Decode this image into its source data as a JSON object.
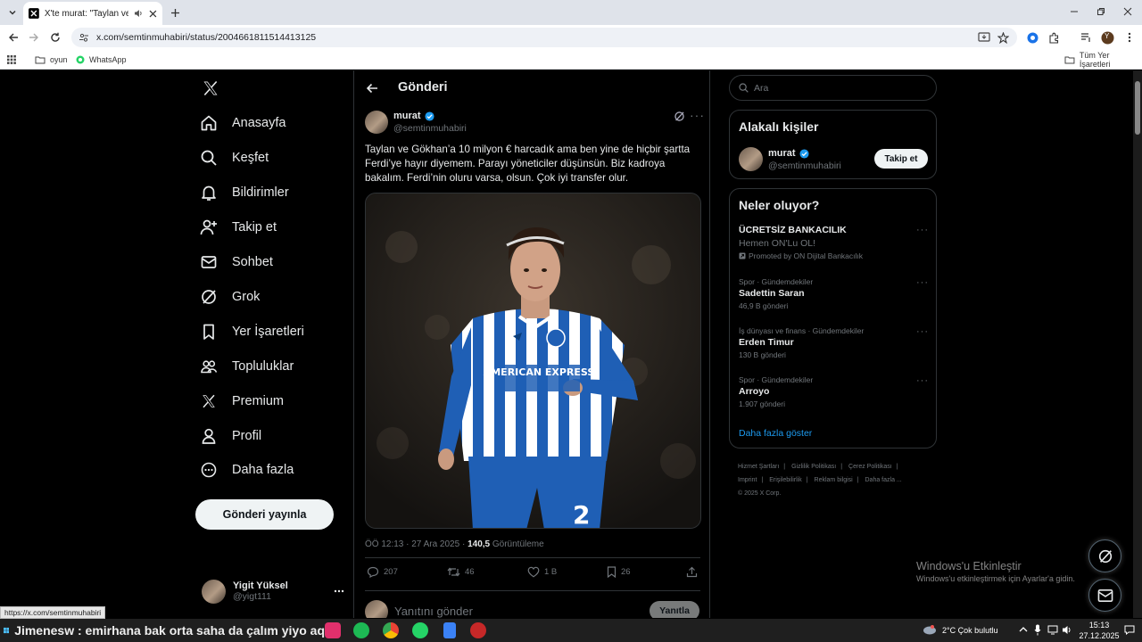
{
  "browser": {
    "tab_title": "X'te murat: \"Taylan ve Gökh",
    "url": "x.com/semtinmuhabiri/status/2004661811514413125",
    "bookmarks": [
      "oyun",
      "WhatsApp"
    ],
    "all_bookmarks": "Tüm Yer İşaretleri",
    "profile_initial": "Y",
    "status_url": "https://x.com/semtinmuhabiri"
  },
  "sidebar": {
    "items": [
      {
        "label": "Anasayfa",
        "icon": "home-icon"
      },
      {
        "label": "Keşfet",
        "icon": "search-icon"
      },
      {
        "label": "Bildirimler",
        "icon": "bell-icon"
      },
      {
        "label": "Takip et",
        "icon": "add-person-icon"
      },
      {
        "label": "Sohbet",
        "icon": "mail-icon"
      },
      {
        "label": "Grok",
        "icon": "grok-icon"
      },
      {
        "label": "Yer İşaretleri",
        "icon": "bookmark-icon"
      },
      {
        "label": "Topluluklar",
        "icon": "communities-icon"
      },
      {
        "label": "Premium",
        "icon": "x-icon"
      },
      {
        "label": "Profil",
        "icon": "person-icon"
      },
      {
        "label": "Daha fazla",
        "icon": "more-circle-icon"
      }
    ],
    "post_button": "Gönderi yayınla",
    "account": {
      "name": "Yigit Yüksel",
      "handle": "@yigt111"
    }
  },
  "main": {
    "title": "Gönderi",
    "post": {
      "author_name": "murat",
      "author_handle": "@semtinmuhabiri",
      "text": "Taylan ve Gökhan’a 10 milyon € harcadık ama ben yine de hiçbir şartta Ferdi’ye hayır diyemem. Parayı yöneticiler düşünsün. Biz kadroya bakalım. Ferdi’nin oluru varsa, olsun. Çok iyi transfer olur.",
      "jersey_text": "AMERICAN EXPRESS",
      "time": "ÖÖ 12:13 · 27 Ara 2025 · ",
      "views_count": "140,5",
      "views_label": " Görüntüleme",
      "replies": "207",
      "reposts": "46",
      "likes": "1 B",
      "bookmarks": "26"
    },
    "reply_placeholder": "Yanıtını gönder",
    "reply_button": "Yanıtla"
  },
  "right": {
    "search_placeholder": "Ara",
    "related_title": "Alakalı kişiler",
    "related_person": {
      "name": "murat",
      "handle": "@semtinmuhabiri",
      "follow": "Takip et"
    },
    "trends_title": "Neler oluyor?",
    "trends": [
      {
        "category": "",
        "title": "ÜCRETSİZ BANKACILIK",
        "subtitle": "Hemen ON'Lu OL!",
        "count": "Promoted by ON Dijital Bankacılık"
      },
      {
        "category": "Spor · Gündemdekiler",
        "title": "Sadettin Saran",
        "subtitle": "",
        "count": "46,9 B gönderi"
      },
      {
        "category": "İş dünyası ve finans · Gündemdekiler",
        "title": "Erden Timur",
        "subtitle": "",
        "count": "130 B gönderi"
      },
      {
        "category": "Spor · Gündemdekiler",
        "title": "Arroyo",
        "subtitle": "",
        "count": "1.907 gönderi"
      }
    ],
    "show_more": "Daha fazla göster",
    "footer": [
      "Hizmet Şartları",
      "|",
      "Gizlilik Politikası",
      "|",
      "Çerez Politikası",
      "|",
      "Imprint",
      "|",
      "Erişilebilirlik",
      "|",
      "Reklam bilgisi",
      "|",
      "Daha fazla ...",
      "© 2025 X Corp."
    ]
  },
  "watermark": {
    "title": "Windows'u Etkinleştir",
    "subtitle": "Windows'u etkinleştirmek için Ayarlar'a gidin."
  },
  "taskbar": {
    "ticker": "Jimenesw : emirhana bak orta saha da çalım yiyo aq",
    "weather": "2°C  Çok bulutlu",
    "time": "15:13",
    "date": "27.12.2025"
  },
  "colors": {
    "accent": "#1d9bf0",
    "background": "#000000",
    "border": "#2f3336",
    "muted": "#71767b",
    "verified": "#1d9bf0",
    "jersey_blue": "#1f5fb5"
  }
}
